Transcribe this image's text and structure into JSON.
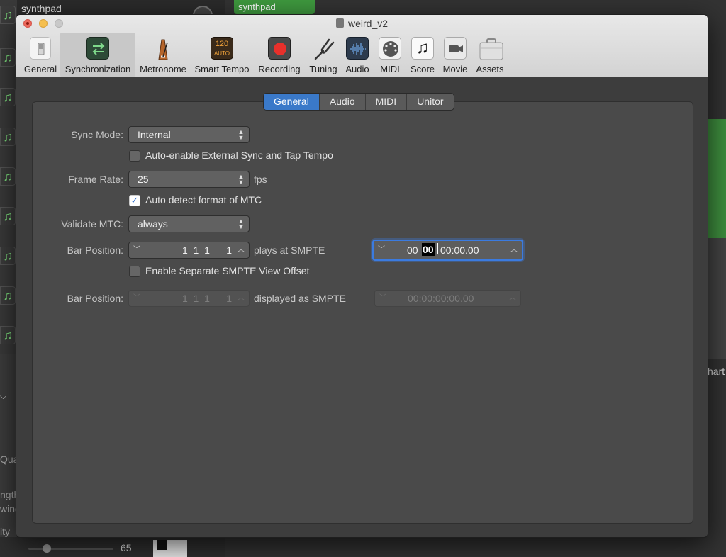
{
  "background": {
    "track_label": "synthpad",
    "region_label": "synthpad",
    "right_partial_text": "hart",
    "left_partial_texts": [
      "Qua",
      "ngth",
      "wing",
      "ity"
    ],
    "slider_value": "65",
    "track_icon": "♫",
    "dropdown_arrow": "⌵"
  },
  "window": {
    "title": "weird_v2"
  },
  "toolbar": {
    "items": [
      {
        "label": "General",
        "icon": "switch-icon"
      },
      {
        "label": "Synchronization",
        "icon": "sync-arrows-icon"
      },
      {
        "label": "Metronome",
        "icon": "metronome-icon"
      },
      {
        "label": "Smart Tempo",
        "icon": "smart-tempo-icon",
        "icon_text_top": "120",
        "icon_text_bottom": "AUTO"
      },
      {
        "label": "Recording",
        "icon": "record-icon"
      },
      {
        "label": "Tuning",
        "icon": "tuning-fork-icon"
      },
      {
        "label": "Audio",
        "icon": "waveform-icon"
      },
      {
        "label": "MIDI",
        "icon": "midi-port-icon"
      },
      {
        "label": "Score",
        "icon": "music-note-icon"
      },
      {
        "label": "Movie",
        "icon": "video-camera-icon"
      },
      {
        "label": "Assets",
        "icon": "briefcase-icon"
      }
    ],
    "selected": "Synchronization"
  },
  "tabs": {
    "items": [
      "General",
      "Audio",
      "MIDI",
      "Unitor"
    ],
    "active": "General"
  },
  "form": {
    "sync_mode_label": "Sync Mode:",
    "sync_mode_value": "Internal",
    "auto_enable_label": "Auto-enable External Sync and Tap Tempo",
    "auto_enable_checked": false,
    "frame_rate_label": "Frame Rate:",
    "frame_rate_value": "25",
    "frame_rate_unit": "fps",
    "auto_detect_label": "Auto detect format of MTC",
    "auto_detect_checked": true,
    "validate_mtc_label": "Validate MTC:",
    "validate_mtc_value": "always",
    "bar_position_label": "Bar Position:",
    "bar_position_value": "1  1  1      1",
    "plays_at_label": "plays at SMPTE",
    "smpte_hours": "00",
    "smpte_minutes": "00",
    "smpte_rest": "00:00.00",
    "enable_offset_label": "Enable Separate SMPTE View Offset",
    "enable_offset_checked": false,
    "bar_position_2_label": "Bar Position:",
    "bar_position_2_value": "1  1  1      1",
    "displayed_as_label": "displayed as SMPTE",
    "smpte_2_value": "00:00:00:00.00"
  },
  "glyphs": {
    "popup_arrows": "▲\n▼",
    "step_down": "﹀",
    "step_up": "︿",
    "check": "✓"
  },
  "colors": {
    "accent": "#3a79c9",
    "record_red": "#e8302b",
    "region_green": "#3f9a3f"
  }
}
